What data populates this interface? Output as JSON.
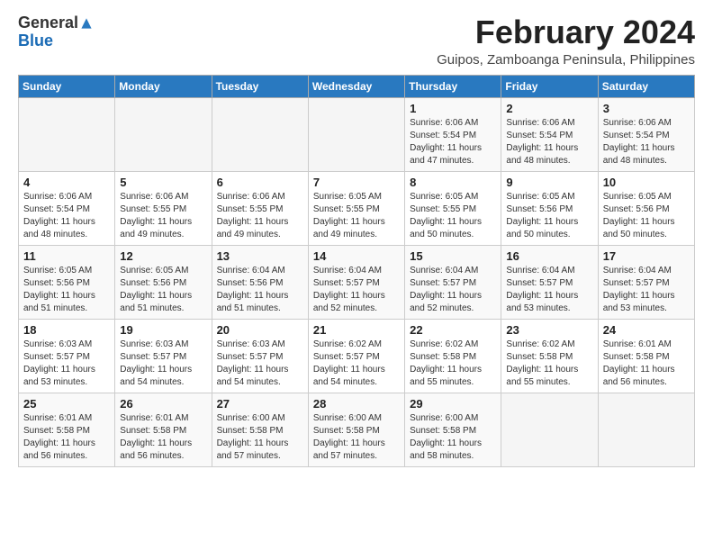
{
  "header": {
    "logo_general": "General",
    "logo_blue": "Blue",
    "month_title": "February 2024",
    "location": "Guipos, Zamboanga Peninsula, Philippines"
  },
  "days_of_week": [
    "Sunday",
    "Monday",
    "Tuesday",
    "Wednesday",
    "Thursday",
    "Friday",
    "Saturday"
  ],
  "weeks": [
    [
      {
        "day": "",
        "content": ""
      },
      {
        "day": "",
        "content": ""
      },
      {
        "day": "",
        "content": ""
      },
      {
        "day": "",
        "content": ""
      },
      {
        "day": "1",
        "content": "Sunrise: 6:06 AM\nSunset: 5:54 PM\nDaylight: 11 hours\nand 47 minutes."
      },
      {
        "day": "2",
        "content": "Sunrise: 6:06 AM\nSunset: 5:54 PM\nDaylight: 11 hours\nand 48 minutes."
      },
      {
        "day": "3",
        "content": "Sunrise: 6:06 AM\nSunset: 5:54 PM\nDaylight: 11 hours\nand 48 minutes."
      }
    ],
    [
      {
        "day": "4",
        "content": "Sunrise: 6:06 AM\nSunset: 5:54 PM\nDaylight: 11 hours\nand 48 minutes."
      },
      {
        "day": "5",
        "content": "Sunrise: 6:06 AM\nSunset: 5:55 PM\nDaylight: 11 hours\nand 49 minutes."
      },
      {
        "day": "6",
        "content": "Sunrise: 6:06 AM\nSunset: 5:55 PM\nDaylight: 11 hours\nand 49 minutes."
      },
      {
        "day": "7",
        "content": "Sunrise: 6:05 AM\nSunset: 5:55 PM\nDaylight: 11 hours\nand 49 minutes."
      },
      {
        "day": "8",
        "content": "Sunrise: 6:05 AM\nSunset: 5:55 PM\nDaylight: 11 hours\nand 50 minutes."
      },
      {
        "day": "9",
        "content": "Sunrise: 6:05 AM\nSunset: 5:56 PM\nDaylight: 11 hours\nand 50 minutes."
      },
      {
        "day": "10",
        "content": "Sunrise: 6:05 AM\nSunset: 5:56 PM\nDaylight: 11 hours\nand 50 minutes."
      }
    ],
    [
      {
        "day": "11",
        "content": "Sunrise: 6:05 AM\nSunset: 5:56 PM\nDaylight: 11 hours\nand 51 minutes."
      },
      {
        "day": "12",
        "content": "Sunrise: 6:05 AM\nSunset: 5:56 PM\nDaylight: 11 hours\nand 51 minutes."
      },
      {
        "day": "13",
        "content": "Sunrise: 6:04 AM\nSunset: 5:56 PM\nDaylight: 11 hours\nand 51 minutes."
      },
      {
        "day": "14",
        "content": "Sunrise: 6:04 AM\nSunset: 5:57 PM\nDaylight: 11 hours\nand 52 minutes."
      },
      {
        "day": "15",
        "content": "Sunrise: 6:04 AM\nSunset: 5:57 PM\nDaylight: 11 hours\nand 52 minutes."
      },
      {
        "day": "16",
        "content": "Sunrise: 6:04 AM\nSunset: 5:57 PM\nDaylight: 11 hours\nand 53 minutes."
      },
      {
        "day": "17",
        "content": "Sunrise: 6:04 AM\nSunset: 5:57 PM\nDaylight: 11 hours\nand 53 minutes."
      }
    ],
    [
      {
        "day": "18",
        "content": "Sunrise: 6:03 AM\nSunset: 5:57 PM\nDaylight: 11 hours\nand 53 minutes."
      },
      {
        "day": "19",
        "content": "Sunrise: 6:03 AM\nSunset: 5:57 PM\nDaylight: 11 hours\nand 54 minutes."
      },
      {
        "day": "20",
        "content": "Sunrise: 6:03 AM\nSunset: 5:57 PM\nDaylight: 11 hours\nand 54 minutes."
      },
      {
        "day": "21",
        "content": "Sunrise: 6:02 AM\nSunset: 5:57 PM\nDaylight: 11 hours\nand 54 minutes."
      },
      {
        "day": "22",
        "content": "Sunrise: 6:02 AM\nSunset: 5:58 PM\nDaylight: 11 hours\nand 55 minutes."
      },
      {
        "day": "23",
        "content": "Sunrise: 6:02 AM\nSunset: 5:58 PM\nDaylight: 11 hours\nand 55 minutes."
      },
      {
        "day": "24",
        "content": "Sunrise: 6:01 AM\nSunset: 5:58 PM\nDaylight: 11 hours\nand 56 minutes."
      }
    ],
    [
      {
        "day": "25",
        "content": "Sunrise: 6:01 AM\nSunset: 5:58 PM\nDaylight: 11 hours\nand 56 minutes."
      },
      {
        "day": "26",
        "content": "Sunrise: 6:01 AM\nSunset: 5:58 PM\nDaylight: 11 hours\nand 56 minutes."
      },
      {
        "day": "27",
        "content": "Sunrise: 6:00 AM\nSunset: 5:58 PM\nDaylight: 11 hours\nand 57 minutes."
      },
      {
        "day": "28",
        "content": "Sunrise: 6:00 AM\nSunset: 5:58 PM\nDaylight: 11 hours\nand 57 minutes."
      },
      {
        "day": "29",
        "content": "Sunrise: 6:00 AM\nSunset: 5:58 PM\nDaylight: 11 hours\nand 58 minutes."
      },
      {
        "day": "",
        "content": ""
      },
      {
        "day": "",
        "content": ""
      }
    ]
  ]
}
